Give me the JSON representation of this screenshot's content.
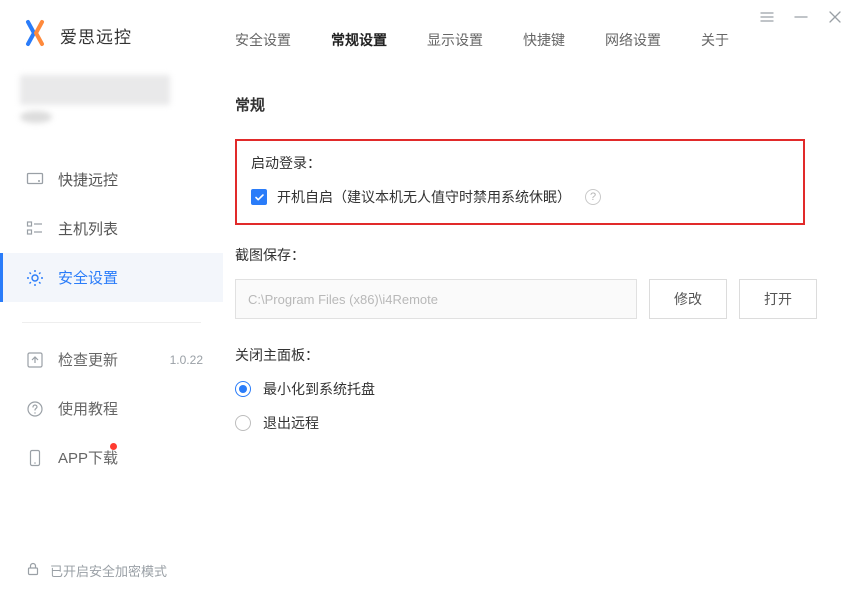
{
  "brand": {
    "title": "爱思远控"
  },
  "window": {},
  "sidebar": {
    "nav": [
      {
        "label": "快捷远控"
      },
      {
        "label": "主机列表"
      },
      {
        "label": "安全设置"
      }
    ],
    "secondary": {
      "update": {
        "label": "检查更新",
        "version": "1.0.22"
      },
      "tutorial": {
        "label": "使用教程"
      },
      "appdl": {
        "label": "APP下载"
      }
    },
    "footer": "已开启安全加密模式"
  },
  "tabs": [
    {
      "label": "安全设置"
    },
    {
      "label": "常规设置"
    },
    {
      "label": "显示设置"
    },
    {
      "label": "快捷键"
    },
    {
      "label": "网络设置"
    },
    {
      "label": "关于"
    }
  ],
  "general": {
    "section_title": "常规",
    "startup": {
      "label": "启动登录：",
      "checkbox_text": "开机自启（建议本机无人值守时禁用系统休眠）",
      "help": "?"
    },
    "screenshot": {
      "label": "截图保存：",
      "path": "C:\\Program Files (x86)\\i4Remote",
      "change_btn": "修改",
      "open_btn": "打开"
    },
    "close_panel": {
      "label": "关闭主面板：",
      "options": [
        {
          "label": "最小化到系统托盘"
        },
        {
          "label": "退出远程"
        }
      ]
    }
  }
}
